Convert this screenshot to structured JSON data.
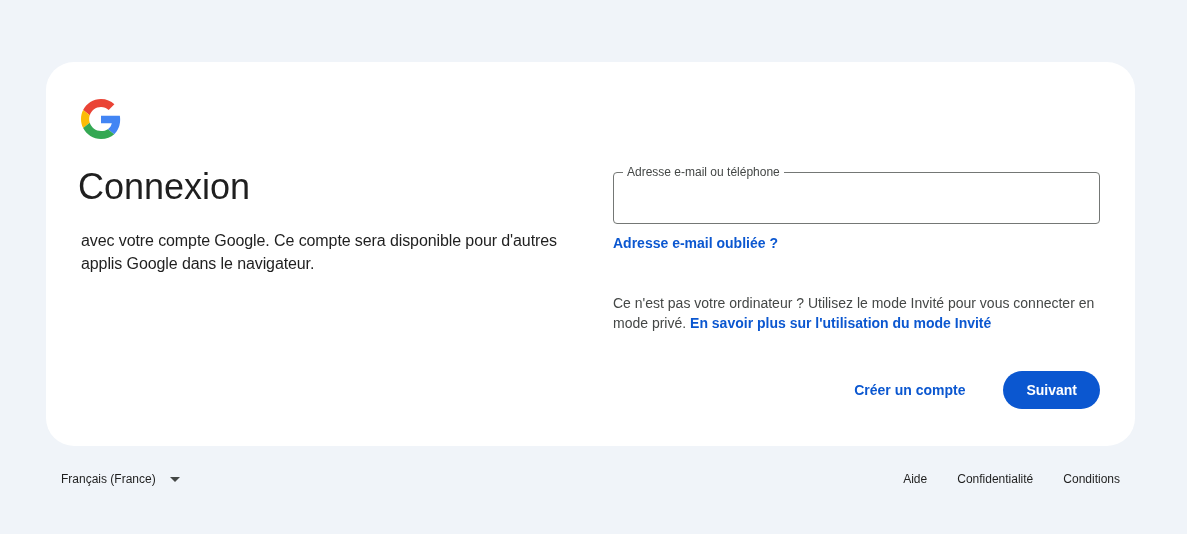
{
  "title": "Connexion",
  "subtitle": "avec votre compte Google. Ce compte sera disponible pour d'autres applis Google dans le navigateur.",
  "email_field": {
    "label": "Adresse e-mail ou téléphone"
  },
  "forgot_link": "Adresse e-mail oubliée ?",
  "guest_note": {
    "text": "Ce n'est pas votre ordinateur ? Utilisez le mode Invité pour vous connecter en mode privé.",
    "link": "En savoir plus sur l'utilisation du mode Invité"
  },
  "create_account": "Créer un compte",
  "next_button": "Suivant",
  "footer": {
    "language": "Français (France)",
    "links": [
      "Aide",
      "Confidentialité",
      "Conditions"
    ]
  }
}
